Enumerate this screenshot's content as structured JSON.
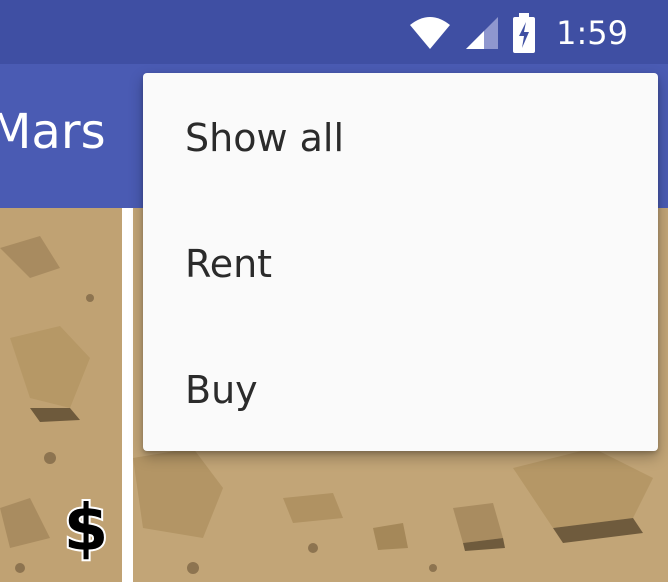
{
  "status_bar": {
    "time": "1:59",
    "icons": [
      "wifi-icon",
      "cell-signal-icon",
      "battery-charging-icon"
    ]
  },
  "app_bar": {
    "title": "Mars"
  },
  "grid": {
    "tiles": [
      {
        "badge_icon": "dollar-sign-icon"
      },
      {
        "badge_icon": ""
      }
    ]
  },
  "menu": {
    "items": [
      {
        "label": "Show all"
      },
      {
        "label": "Rent"
      },
      {
        "label": "Buy"
      }
    ]
  },
  "colors": {
    "status_bar": "#3f4fa3",
    "app_bar": "#4a5bb3",
    "menu_bg": "#fafafa",
    "menu_text": "#2b2b2b",
    "sand": "#c4a678"
  }
}
